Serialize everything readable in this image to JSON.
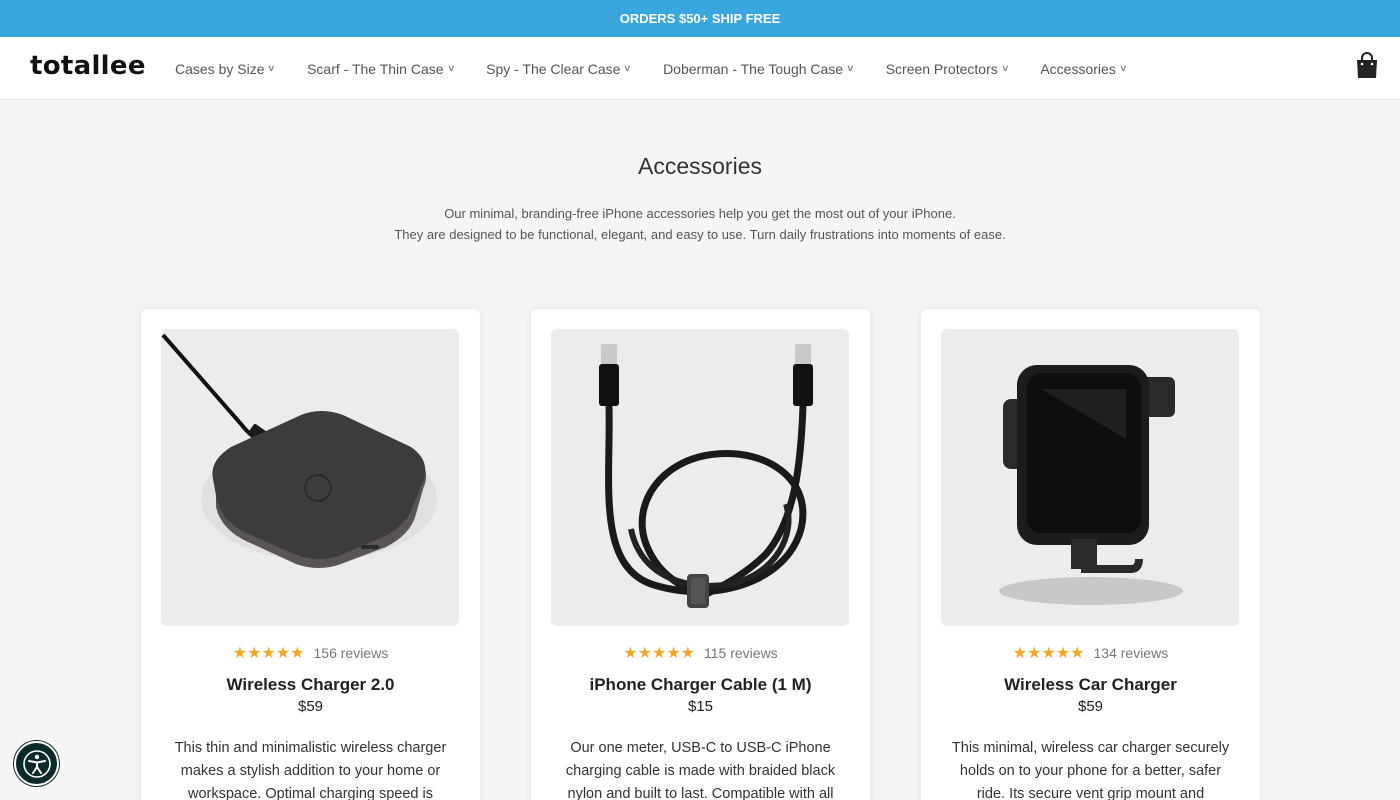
{
  "announcement": {
    "text": "ORDERS $50+ SHIP FREE"
  },
  "header": {
    "logo": "totallee",
    "nav": [
      {
        "label": "Cases by Size"
      },
      {
        "label": "Scarf - The Thin Case"
      },
      {
        "label": "Spy - The Clear Case"
      },
      {
        "label": "Doberman - The Tough Case"
      },
      {
        "label": "Screen Protectors"
      },
      {
        "label": "Accessories"
      }
    ],
    "cart_icon": "shopping-bag-icon"
  },
  "page": {
    "title": "Accessories",
    "intro_line1": "Our minimal, branding-free iPhone accessories help you get the most out of your iPhone.",
    "intro_line2": "They are designed to be functional, elegant, and easy to use. Turn daily frustrations into moments of ease."
  },
  "products": [
    {
      "stars": "★★★★★",
      "reviews": "156 reviews",
      "title": "Wireless Charger 2.0",
      "price": "$59",
      "description": "This thin and minimalistic wireless charger makes a stylish addition to your home or workspace. Optimal charging speed is"
    },
    {
      "stars": "★★★★★",
      "reviews": "115 reviews",
      "title": "iPhone Charger Cable (1 M)",
      "price": "$15",
      "description": "Our one meter, USB-C to USB-C iPhone charging cable is made with braided black nylon and built to last. Compatible with all"
    },
    {
      "stars": "★★★★★",
      "reviews": "134 reviews",
      "title": "Wireless Car Charger",
      "price": "$59",
      "description": "This minimal, wireless car charger securely holds on to your phone for a better, safer ride. Its secure vent grip mount and"
    }
  ],
  "colors": {
    "announcement_bg": "#39a6dd",
    "star": "#f5a623",
    "a11y_bg": "#0b2b2b"
  },
  "accessibility_icon": "accessibility-icon"
}
